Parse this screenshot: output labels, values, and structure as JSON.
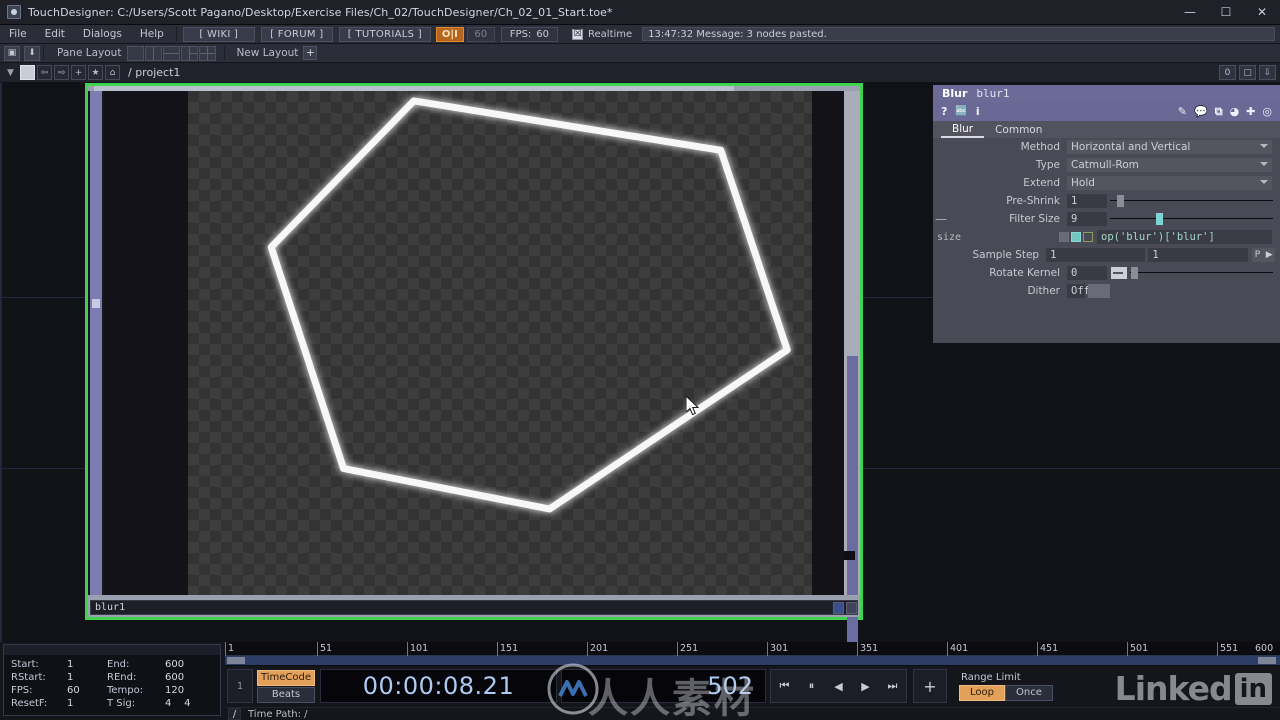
{
  "window": {
    "title": "TouchDesigner: C:/Users/Scott Pagano/Desktop/Exercise Files/Ch_02/TouchDesigner/Ch_02_01_Start.toe*",
    "app_icon": "touchdesigner-icon",
    "minimize": "—",
    "maximize": "☐",
    "close": "✕"
  },
  "menubar": {
    "items": [
      "File",
      "Edit",
      "Dialogs",
      "Help"
    ],
    "links": [
      "[ WIKI ]",
      "[ FORUM ]",
      "[ TUTORIALS ]"
    ],
    "oii": "O|I",
    "oii_value": "60",
    "fps_label": "FPS:",
    "fps_value": "60",
    "realtime_label": "Realtime",
    "realtime_checked": "☒",
    "message": "13:47:32 Message: 3 nodes pasted."
  },
  "panebar": {
    "label": "Pane Layout",
    "new_layout": "New Layout",
    "plus": "+",
    "icon_left": "image-icon",
    "icon_left2": "save-icon"
  },
  "pathbar": {
    "path": "/ project1",
    "caret": "▼",
    "back": "⇦",
    "forward": "⇨",
    "plus": "+",
    "star": "★",
    "home": "⌂",
    "right_value": "0",
    "right_btn1": "window-icon",
    "right_btn2": "pin-icon"
  },
  "viewer": {
    "node_name": "blur1",
    "border_color": "#3fd44f"
  },
  "parameters": {
    "op_type": "Blur",
    "op_name": "blur1",
    "tools": {
      "help": "?",
      "lang": "lang-icon",
      "info": "i",
      "right_icons": [
        "pencil-icon",
        "comment-icon",
        "copy-icon",
        "palette-icon",
        "plus-icon",
        "target-icon"
      ]
    },
    "tabs": [
      {
        "label": "Blur",
        "active": true
      },
      {
        "label": "Common",
        "active": false
      }
    ],
    "rows": [
      {
        "kind": "menu",
        "label": "Method",
        "value": "Horizontal and Vertical"
      },
      {
        "kind": "menu",
        "label": "Type",
        "value": "Catmull-Rom"
      },
      {
        "kind": "menu",
        "label": "Extend",
        "value": "Hold"
      },
      {
        "kind": "slider",
        "label": "Pre-Shrink",
        "value": "1",
        "pos": 4
      },
      {
        "kind": "slider",
        "label": "Filter Size",
        "value": "9",
        "pos": 28,
        "teal": true,
        "minus": "—"
      },
      {
        "kind": "expr",
        "label": "size",
        "value": "op('blur')['blur']"
      },
      {
        "kind": "dual",
        "label": "Sample Step",
        "value": "1",
        "value2": "1",
        "p": "P",
        "arrow": "▶"
      },
      {
        "kind": "kernel",
        "label": "Rotate Kernel",
        "value": "0",
        "pos": 2
      },
      {
        "kind": "toggle",
        "label": "Dither",
        "value": "Off"
      }
    ]
  },
  "timeline": {
    "ruler_ticks": [
      "1",
      "51",
      "101",
      "151",
      "201",
      "251",
      "301",
      "351",
      "401",
      "451",
      "501",
      "551",
      "600"
    ],
    "info": {
      "rows": [
        {
          "k1": "Start:",
          "v1": "1",
          "k2": "End:",
          "v2": "600"
        },
        {
          "k1": "RStart:",
          "v1": "1",
          "k2": "REnd:",
          "v2": "600"
        },
        {
          "k1": "FPS:",
          "v1": "60",
          "k2": "Tempo:",
          "v2": "120"
        },
        {
          "k1": "ResetF:",
          "v1": "1",
          "k2": "T Sig:",
          "v2": "4",
          "v3": "4"
        }
      ]
    },
    "frame_index": "1",
    "timecode_btn": "TimeCode",
    "beats_btn": "Beats",
    "timecode": "00:00:08.21",
    "frame": "502",
    "transport": [
      "⏮",
      "⏸",
      "◀",
      "▶",
      "⏭"
    ],
    "add_button": "+",
    "range_limit_label": "Range Limit",
    "range_loop": "Loop",
    "range_once": "Once",
    "time_path_slash": "/",
    "time_path_text": "Time Path: /"
  },
  "watermarks": {
    "chinese": "人人素材",
    "linkedin_text": "Linked",
    "linkedin_in": "in"
  }
}
